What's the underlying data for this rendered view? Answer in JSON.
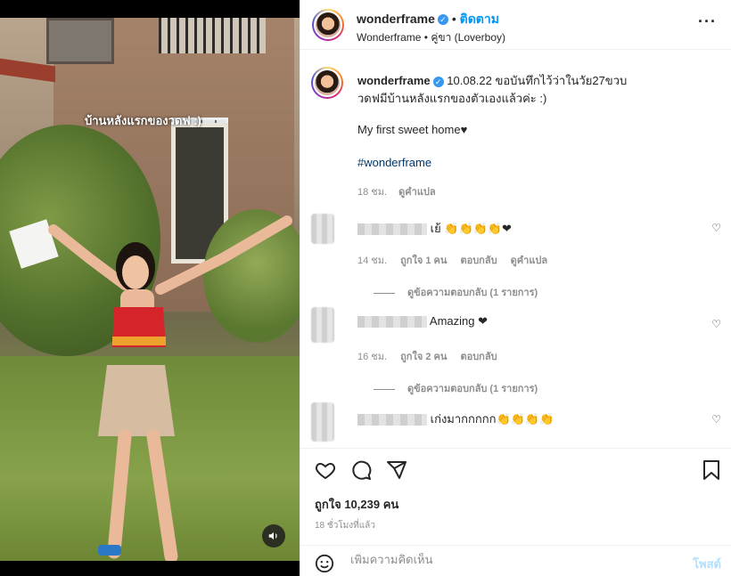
{
  "media": {
    "overlay_text": "บ้านหลังแรกของวดฟ :)",
    "sound_icon": "speaker-icon"
  },
  "header": {
    "username": "wonderframe",
    "follow_label": "ติดตาม",
    "subtitle": "Wonderframe • คู่ขา (Loverboy)",
    "more_icon": "more-icon"
  },
  "caption": {
    "username": "wonderframe",
    "line1": "10.08.22 ขอบันทึกไว้ว่าในวัย27ขวบ",
    "line2": "วดฟมีบ้านหลังแรกของตัวเองแล้วค่ะ :)",
    "line3": "My first sweet home♥",
    "hashtag": "#wonderframe",
    "time": "18 ชม.",
    "translate": "ดูคำแปล"
  },
  "comments": [
    {
      "text": "เย้ 👏👏👏👏❤",
      "time": "14 ชม.",
      "likes": "ถูกใจ 1 คน",
      "reply": "ตอบกลับ",
      "translate": "ดูคำแปล",
      "view_replies": "ดูข้อความตอบกลับ (1 รายการ)"
    },
    {
      "text": "Amazing ❤",
      "time": "16 ชม.",
      "likes": "ถูกใจ 2 คน",
      "reply": "ตอบกลับ",
      "view_replies": "ดูข้อความตอบกลับ (1 รายการ)"
    },
    {
      "text": "เก่งมากกกกก👏👏👏👏"
    }
  ],
  "footer": {
    "likes": "ถูกใจ 10,239 คน",
    "time": "18 ชั่วโมงที่แล้ว",
    "comment_placeholder": "เพิ่มความคิดเห็น",
    "post_label": "โพสต์"
  },
  "colors": {
    "accent": "#0095f6",
    "verified": "#3897f0",
    "post_disabled": "#b2dffc",
    "muted": "#8e8e8e"
  }
}
